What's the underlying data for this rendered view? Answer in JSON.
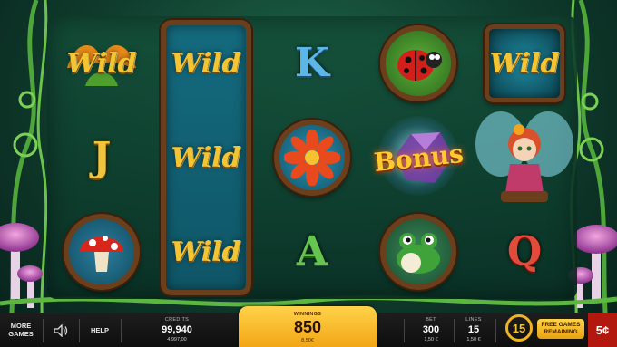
{
  "reels": [
    {
      "wild_stack": false,
      "cells": [
        {
          "symbol": "wild",
          "text": "Wild"
        },
        {
          "symbol": "royal-j",
          "text": "J"
        },
        {
          "symbol": "mushroom",
          "text": ""
        }
      ]
    },
    {
      "wild_stack": true,
      "cells": [
        {
          "symbol": "wild",
          "text": "Wild"
        },
        {
          "symbol": "wild",
          "text": "Wild"
        },
        {
          "symbol": "wild",
          "text": "Wild"
        }
      ]
    },
    {
      "wild_stack": false,
      "cells": [
        {
          "symbol": "royal-k",
          "text": "K"
        },
        {
          "symbol": "flower",
          "text": ""
        },
        {
          "symbol": "royal-a",
          "text": "A"
        }
      ]
    },
    {
      "wild_stack": false,
      "cells": [
        {
          "symbol": "ladybug",
          "text": ""
        },
        {
          "symbol": "bonus",
          "text": "Bonus"
        },
        {
          "symbol": "frog",
          "text": ""
        }
      ]
    },
    {
      "wild_stack": false,
      "cells": [
        {
          "symbol": "wild",
          "text": "Wild"
        },
        {
          "symbol": "fairy",
          "text": ""
        },
        {
          "symbol": "royal-q",
          "text": "Q"
        }
      ]
    }
  ],
  "bar": {
    "more_games": "MORE GAMES",
    "sound_icon": "speaker-icon",
    "help": "HELP",
    "credits_label": "CREDITS",
    "credits_value": "99,940",
    "credits_money": "4.997,00",
    "winnings_label": "WINNINGS",
    "winnings_value": "850",
    "winnings_money": "8,50€",
    "bet_label": "BET",
    "bet_value": "300",
    "bet_money": "1,50 €",
    "lines_label": "LINES",
    "lines_value": "15",
    "lines_money": "1,50 €",
    "free_games_count": "15",
    "free_games_label": "FREE GAMES REMAINING",
    "denomination": "5¢"
  },
  "colors": {
    "accent": "#f2a615",
    "denom_bg": "#b3180e",
    "frame_wood": "#6b3e1c"
  }
}
